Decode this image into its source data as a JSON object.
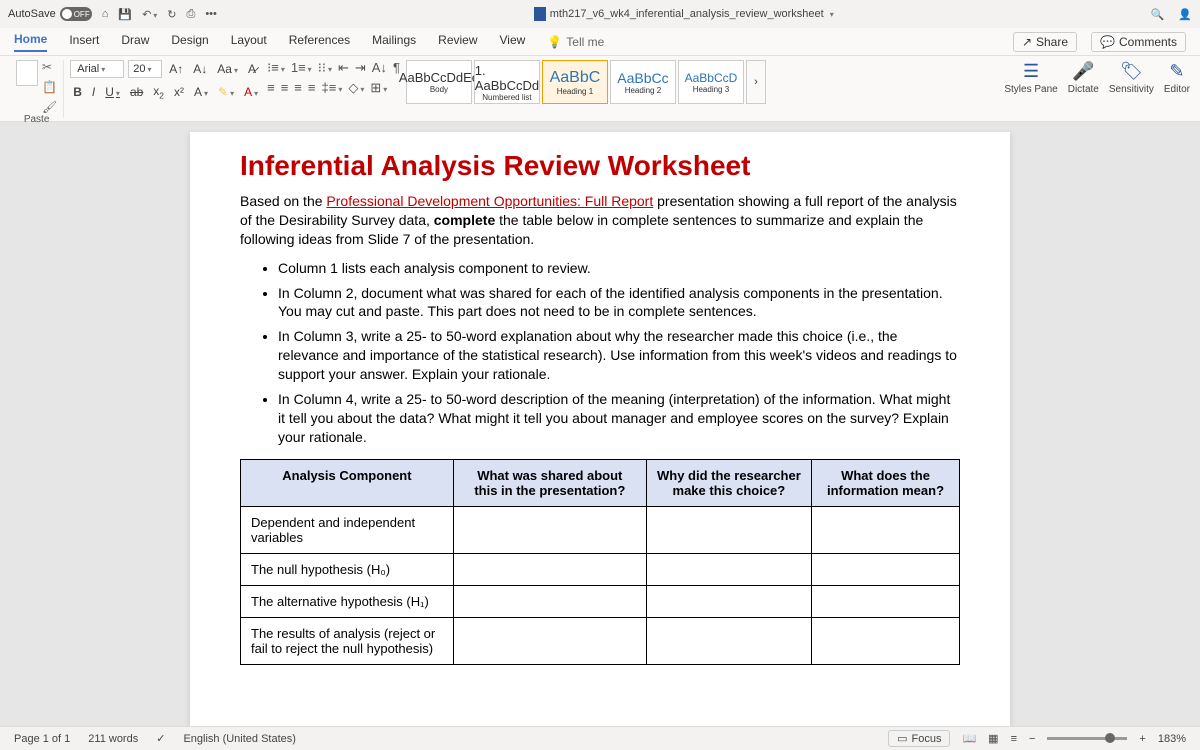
{
  "titlebar": {
    "autosave": "AutoSave",
    "autosave_state": "OFF",
    "doc_title": "mth217_v6_wk4_inferential_analysis_review_worksheet"
  },
  "tabs": {
    "items": [
      "Home",
      "Insert",
      "Draw",
      "Design",
      "Layout",
      "References",
      "Mailings",
      "Review",
      "View"
    ],
    "tellme": "Tell me",
    "share": "Share",
    "comments": "Comments"
  },
  "ribbon": {
    "paste": "Paste",
    "font_name": "Arial",
    "font_size": "20",
    "styles": [
      {
        "sample": "AaBbCcDdEe",
        "label": "Body"
      },
      {
        "sample": "1. AaBbCcDd",
        "label": "Numbered list"
      },
      {
        "sample": "AaBbC",
        "label": "Heading 1"
      },
      {
        "sample": "AaBbCc",
        "label": "Heading 2"
      },
      {
        "sample": "AaBbCcD",
        "label": "Heading 3"
      }
    ],
    "styles_pane": "Styles Pane",
    "dictate": "Dictate",
    "sensitivity": "Sensitivity",
    "editor": "Editor"
  },
  "document": {
    "title": "Inferential Analysis Review Worksheet",
    "intro_pre": "Based on the ",
    "intro_link": "Professional Development Opportunities: Full Report",
    "intro_post1": " presentation showing a full report of the analysis of the Desirability Survey data, ",
    "intro_bold": "complete",
    "intro_post2": " the table below in complete sentences to summarize and explain the following ideas from Slide 7 of the presentation.",
    "bullets": [
      "Column 1 lists each analysis component to review.",
      "In Column 2, document what was shared for each of the identified analysis components in the presentation. You may cut and paste. This part does not need to be in complete sentences.",
      "In Column 3, write a 25- to 50-word explanation about why the researcher made this choice (i.e., the relevance and importance of the statistical research). Use information from this week's videos and readings to support your answer. Explain your rationale.",
      "In Column 4, write a 25- to 50-word description of the meaning (interpretation) of the information. What might it tell you about the data? What might it tell you about manager and employee scores on the survey? Explain your rationale."
    ],
    "table": {
      "headers": [
        "Analysis Component",
        "What was shared about this in the presentation?",
        "Why did the researcher make this choice?",
        "What does the information mean?"
      ],
      "rows": [
        "Dependent and independent variables",
        "The null hypothesis (H₀)",
        "The alternative hypothesis (H₁)",
        "The results of analysis (reject or fail to reject the null hypothesis)"
      ]
    }
  },
  "statusbar": {
    "page": "Page 1 of 1",
    "words": "211 words",
    "language": "English (United States)",
    "focus": "Focus",
    "zoom": "183%"
  }
}
